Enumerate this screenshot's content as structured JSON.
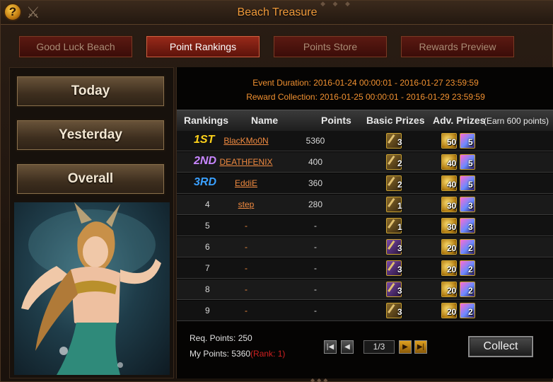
{
  "window": {
    "title": "Beach Treasure",
    "help_label": "?"
  },
  "tabs": [
    {
      "label": "Good Luck Beach",
      "active": false
    },
    {
      "label": "Point Rankings",
      "active": true
    },
    {
      "label": "Points Store",
      "active": false
    },
    {
      "label": "Rewards Preview",
      "active": false
    }
  ],
  "sidebar": {
    "buttons": [
      "Today",
      "Yesterday",
      "Overall"
    ]
  },
  "event": {
    "duration": "Event Duration: 2016-01-24 00:00:01 - 2016-01-27 23:59:59",
    "collection": "Reward Collection: 2016-01-25 00:00:01 - 2016-01-29 23:59:59"
  },
  "table": {
    "headers": {
      "rankings": "Rankings",
      "name": "Name",
      "points": "Points",
      "basic": "Basic Prizes",
      "adv": "Adv. Prizes",
      "adv_note": "(Earn 600 points)"
    },
    "rows": [
      {
        "rank": "1ST",
        "rank_color": "#ffd21a",
        "name": "BlacKMo0N",
        "points": "5360",
        "basic": "3",
        "basic_style": "brown",
        "gold": "50",
        "gem": "5"
      },
      {
        "rank": "2ND",
        "rank_color": "#c886ff",
        "name": "DEATHFENIX",
        "points": "400",
        "basic": "2",
        "basic_style": "brown",
        "gold": "40",
        "gem": "5"
      },
      {
        "rank": "3RD",
        "rank_color": "#3aa0ff",
        "name": "EddiE",
        "points": "360",
        "basic": "2",
        "basic_style": "brown",
        "gold": "40",
        "gem": "5"
      },
      {
        "rank": "4",
        "rank_color": "",
        "name": "step",
        "points": "280",
        "basic": "1",
        "basic_style": "brown",
        "gold": "30",
        "gem": "3"
      },
      {
        "rank": "5",
        "rank_color": "",
        "name": "-",
        "points": "-",
        "basic": "1",
        "basic_style": "brown",
        "gold": "30",
        "gem": "3"
      },
      {
        "rank": "6",
        "rank_color": "",
        "name": "-",
        "points": "-",
        "basic": "3",
        "basic_style": "purple",
        "gold": "20",
        "gem": "2"
      },
      {
        "rank": "7",
        "rank_color": "",
        "name": "-",
        "points": "-",
        "basic": "3",
        "basic_style": "purple",
        "gold": "20",
        "gem": "2"
      },
      {
        "rank": "8",
        "rank_color": "",
        "name": "-",
        "points": "-",
        "basic": "3",
        "basic_style": "purple",
        "gold": "20",
        "gem": "2"
      },
      {
        "rank": "9",
        "rank_color": "",
        "name": "-",
        "points": "-",
        "basic": "3",
        "basic_style": "brown",
        "gold": "20",
        "gem": "2"
      }
    ]
  },
  "footer": {
    "req_points": "Req. Points: 250",
    "my_points": "My Points: 5360",
    "rank_note": "(Rank: 1)",
    "page": "1/3",
    "collect_label": "Collect"
  },
  "icons": {
    "pager": [
      "first-page-icon",
      "prev-page-icon",
      "next-page-icon",
      "last-page-icon"
    ],
    "prizes": [
      "sword-prize-icon",
      "gold-prize-icon",
      "gem-prize-icon"
    ]
  }
}
